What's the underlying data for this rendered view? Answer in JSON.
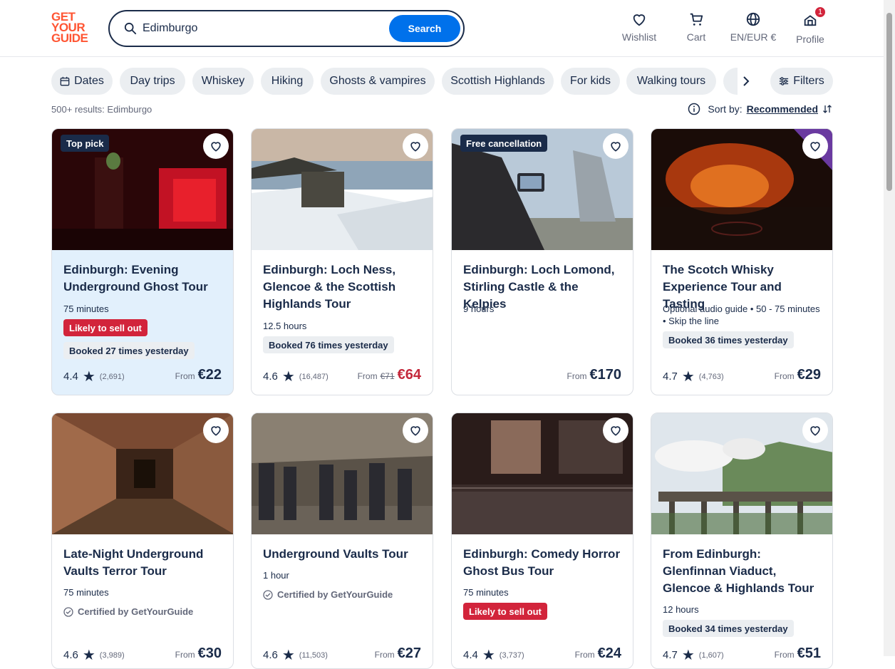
{
  "logo": {
    "line1": "GET",
    "line2": "YOUR",
    "line3": "GUIDE"
  },
  "search": {
    "value": "Edimburgo",
    "button": "Search"
  },
  "nav": {
    "wishlist": "Wishlist",
    "cart": "Cart",
    "lang": "EN/EUR €",
    "profile": "Profile",
    "profile_badge": "1"
  },
  "chips": {
    "dates": "Dates",
    "c1": "Day trips",
    "c2": "Whiskey",
    "c3": "Hiking",
    "c4": "Ghosts & vampires",
    "c5": "Scottish Highlands",
    "c6": "For kids",
    "c7": "Walking tours",
    "filters": "Filters"
  },
  "results": {
    "count": "500+ results: Edimburgo",
    "sort_label": "Sort by:",
    "sort_value": "Recommended"
  },
  "cards": [
    {
      "tag": "Top pick",
      "title": "Edinburgh: Evening Underground Ghost Tour",
      "duration": "75 minutes",
      "sell": "Likely to sell out",
      "booked": "Booked 27 times yesterday",
      "rating": "4.4",
      "count": "(2,691)",
      "from": "From",
      "price": "€22"
    },
    {
      "title": "Edinburgh: Loch Ness, Glencoe & the Scottish Highlands Tour",
      "duration": "12.5 hours",
      "booked": "Booked 76 times yesterday",
      "rating": "4.6",
      "count": "(16,487)",
      "from": "From",
      "old_price": "€71",
      "price": "€64"
    },
    {
      "tag": "Free cancellation",
      "title": "Edinburgh: Loch Lomond, Stirling Castle & the Kelpies",
      "duration": "9 hours",
      "from": "From",
      "price": "€170"
    },
    {
      "title": "The Scotch Whisky Experience Tour and Tasting",
      "duration": "Optional audio guide • 50 - 75 minutes • Skip the line",
      "booked": "Booked 36 times yesterday",
      "rating": "4.7",
      "count": "(4,763)",
      "from": "From",
      "price": "€29"
    },
    {
      "title": "Late-Night Underground Vaults Terror Tour",
      "duration": "75 minutes",
      "cert": "Certified by GetYourGuide",
      "rating": "4.6",
      "count": "(3,989)",
      "from": "From",
      "price": "€30"
    },
    {
      "title": "Underground Vaults Tour",
      "duration": "1 hour",
      "cert": "Certified by GetYourGuide",
      "rating": "4.6",
      "count": "(11,503)",
      "from": "From",
      "price": "€27"
    },
    {
      "title": "Edinburgh: Comedy Horror Ghost Bus Tour",
      "duration": "75 minutes",
      "sell": "Likely to sell out",
      "rating": "4.4",
      "count": "(3,737)",
      "from": "From",
      "price": "€24"
    },
    {
      "title": "From Edinburgh: Glenfinnan Viaduct, Glencoe & Highlands Tour",
      "duration": "12 hours",
      "booked": "Booked 34 times yesterday",
      "rating": "4.7",
      "count": "(1,607)",
      "from": "From",
      "price": "€51"
    }
  ],
  "colors": {
    "brand": "#ff5533",
    "accent": "#0071eb",
    "navy": "#1a2b49",
    "alert": "#d2243b"
  }
}
